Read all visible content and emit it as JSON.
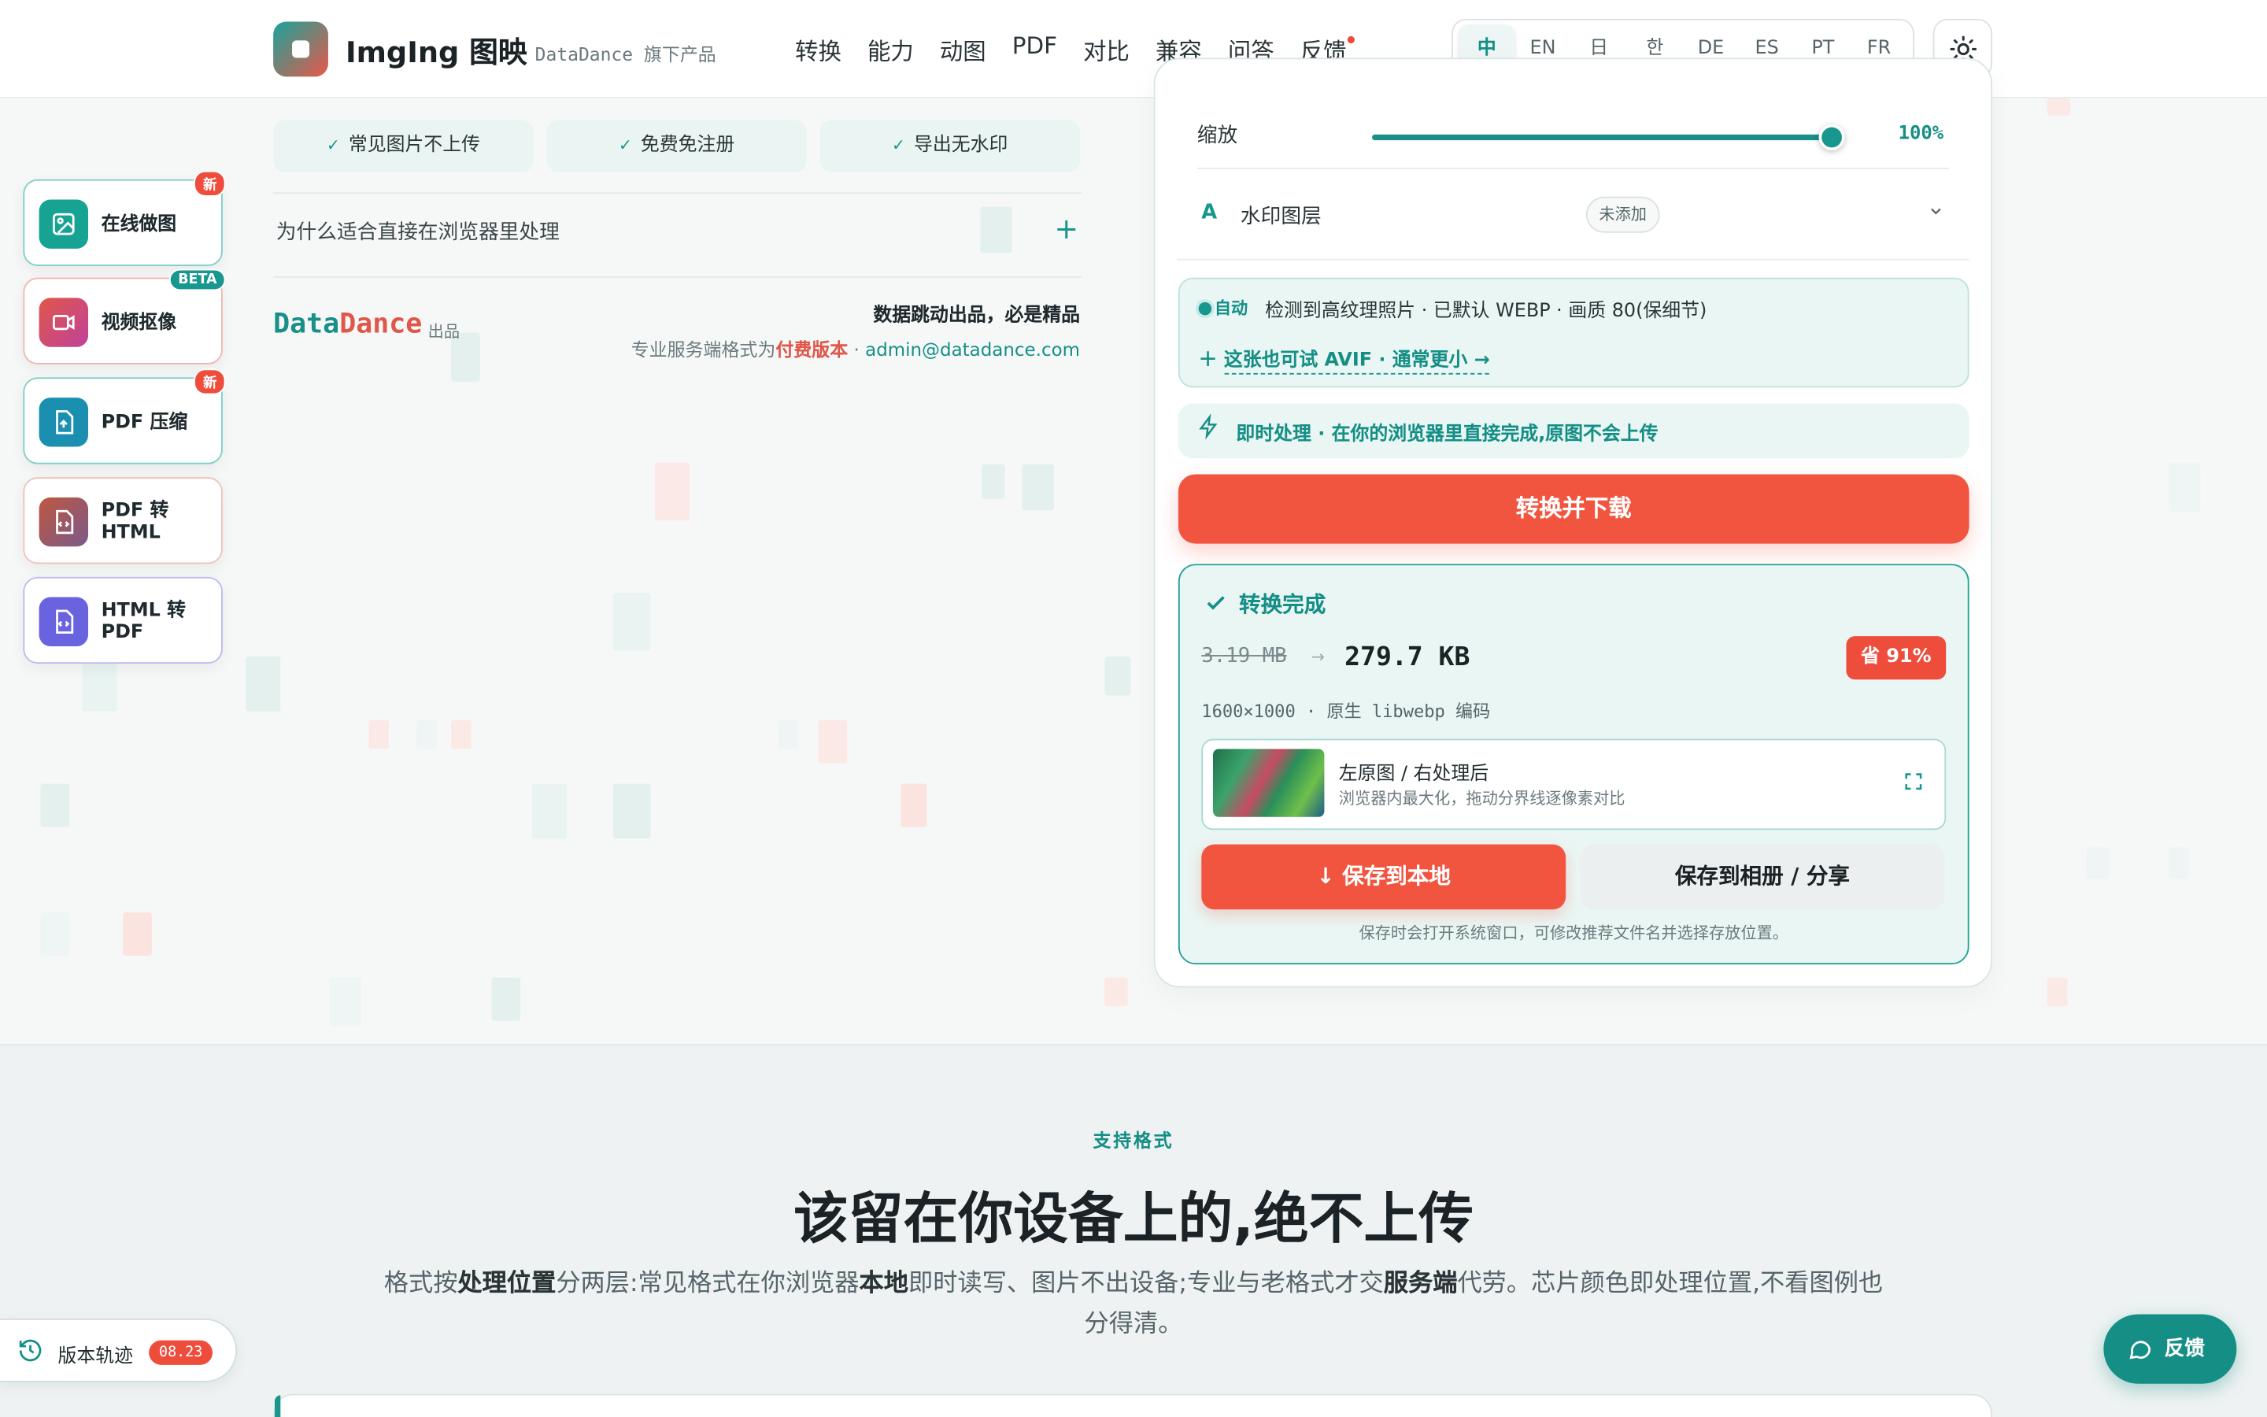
{
  "header": {
    "brand": "ImgIng 图映",
    "sub": "· DataDance 旗下产品",
    "nav": [
      "转换",
      "能力",
      "动图",
      "PDF",
      "对比",
      "兼容",
      "问答",
      "反馈"
    ],
    "languages": [
      "中",
      "EN",
      "日",
      "한",
      "DE",
      "ES",
      "PT",
      "FR"
    ],
    "active_language": "中"
  },
  "features": {
    "chips": [
      "常见图片不上传",
      "免费免注册",
      "导出无水印"
    ],
    "faq_question": "为什么适合直接在浏览器里处理",
    "faq_toggle": "+"
  },
  "footer_brand": {
    "logo_a": "Data",
    "logo_b": "Dance",
    "made_by": "出品",
    "slogan": "数据跳动出品，必是精品",
    "contact_prefix": "专业服务端格式为",
    "contact_paid": "付费版本",
    "contact_sep": " · ",
    "contact_email": "admin@datadance.com"
  },
  "tools": [
    {
      "label": "在线做图",
      "badge": "新"
    },
    {
      "label": "视频抠像",
      "badge": "BETA"
    },
    {
      "label": "PDF 压缩",
      "badge": "新"
    },
    {
      "label": "PDF 转 HTML",
      "badge": ""
    },
    {
      "label": "HTML 转 PDF",
      "badge": ""
    }
  ],
  "panel": {
    "scale_label": "缩放",
    "scale_value": "100%",
    "scale_fraction": 1.0,
    "watermark_label": "水印图层",
    "watermark_status": "未添加",
    "auto_label": "自动",
    "auto_text": "检测到高纹理照片 · 已默认 WEBP · 画质 80(保细节)",
    "auto_try": "这张也可试 AVIF · 通常更小 →",
    "instant_text": "即时处理 · 在你的浏览器里直接完成,原图不会上传",
    "convert_button": "转换并下载",
    "done_title": "转换完成",
    "size_old": "3.19 MB",
    "size_arrow": "→",
    "size_new": "279.7 KB",
    "saved_badge": "省 91%",
    "meta": "1600×1000 · 原生 libwebp 编码",
    "compare_title": "左原图 / 右处理后",
    "compare_sub": "浏览器内最大化，拖动分界线逐像素对比",
    "save_local": "↓ 保存到本地",
    "save_album": "保存到相册 / 分享",
    "save_note": "保存时会打开系统窗口，可修改推荐文件名并选择存放位置。"
  },
  "section2": {
    "kicker": "支持格式",
    "title": "该留在你设备上的,绝不上传",
    "desc_1": "格式按",
    "desc_b1": "处理位置",
    "desc_2": "分两层:常见格式在你浏览器",
    "desc_b2": "本地",
    "desc_3": "即时读写、图片不出设备;专业与老格式才交",
    "desc_b3": "服务端",
    "desc_4": "代劳。芯片颜色即处理位置,不看图例也分得清。"
  },
  "version": {
    "label": "版本轨迹",
    "tag": "08.23"
  },
  "feedback_fab": "反馈",
  "colors": {
    "accent": "#17978d",
    "primary": "#f1543f",
    "badge": "#ef4d3c"
  }
}
